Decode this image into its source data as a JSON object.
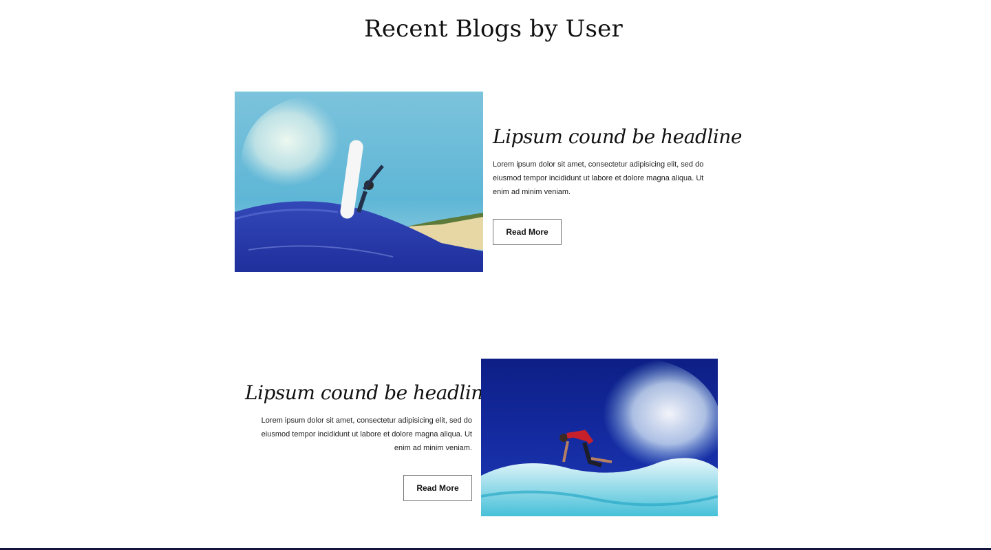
{
  "section": {
    "title": "Recent Blogs by User"
  },
  "posts": [
    {
      "headline": "Lipsum cound be headline",
      "excerpt": "Lorem ipsum dolor sit amet, consectetur adipisicing elit, sed do eiusmod tempor incididunt ut labore et dolore magna aliqua. Ut enim ad minim veniam.",
      "button_label": "Read More",
      "image_alt": "surfer performing aerial on wave"
    },
    {
      "headline": "Lipsum cound be headline",
      "excerpt": "Lorem ipsum dolor sit amet, consectetur adipisicing elit, sed do eiusmod tempor incididunt ut labore et dolore magna aliqua. Ut enim ad minim veniam.",
      "button_label": "Read More",
      "image_alt": "surfer carving through spray"
    }
  ],
  "colors": {
    "text": "#111111",
    "button_border": "#777777",
    "footer_rule": "#14133a"
  }
}
